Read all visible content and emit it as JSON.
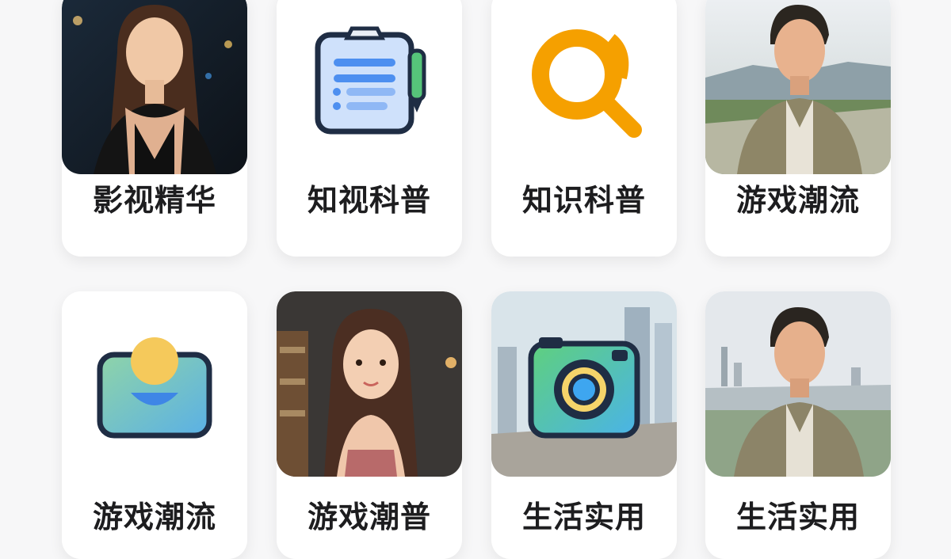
{
  "cards": [
    {
      "label": "影视精华",
      "icon": "portrait-woman-night-photo"
    },
    {
      "label": "知视科普",
      "icon": "clipboard-icon"
    },
    {
      "label": "知识科普",
      "icon": "search-icon"
    },
    {
      "label": "游戏潮流",
      "icon": "portrait-man-outdoor-photo"
    },
    {
      "label": "游戏潮流",
      "icon": "wallet-icon"
    },
    {
      "label": "游戏潮普",
      "icon": "illustrated-woman-portrait"
    },
    {
      "label": "生活实用",
      "icon": "camera-icon"
    },
    {
      "label": "生活实用",
      "icon": "portrait-man-city-photo"
    }
  ],
  "colors": {
    "background": "#f7f7f8",
    "card": "#ffffff",
    "label_text": "#1d1d1f",
    "search_orange": "#f5a000",
    "clipboard_blue": "#4d8ff0",
    "camera_green": "#56d68a"
  }
}
